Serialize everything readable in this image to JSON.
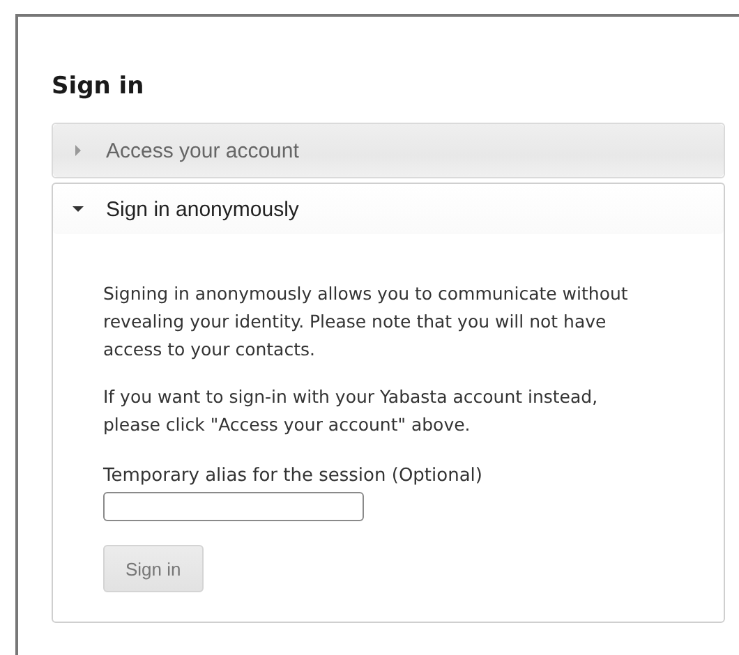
{
  "title": "Sign in",
  "sections": [
    {
      "label": "Access your account",
      "expanded": false
    },
    {
      "label": "Sign in anonymously",
      "expanded": true,
      "paragraphs": [
        "Signing in anonymously allows you to communicate without revealing your identity. Please note that you will not have access to your contacts.",
        "If you want to sign-in with your Yabasta account instead, please click \"Access your account\" above."
      ],
      "field_label": "Temporary alias for the session (Optional)",
      "button": {
        "label": "Sign in",
        "disabled": true
      }
    }
  ]
}
